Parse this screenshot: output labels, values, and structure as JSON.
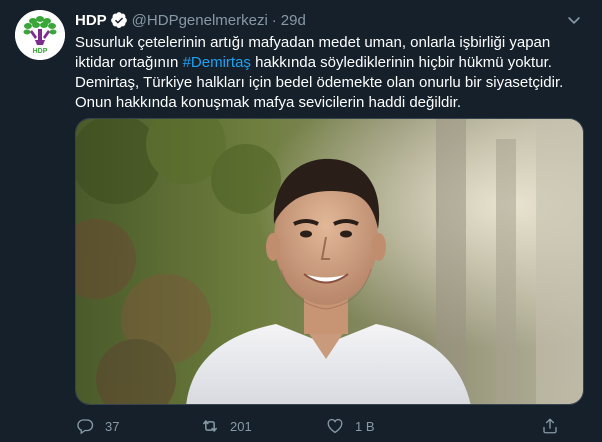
{
  "account": {
    "name": "HDP",
    "handle": "@HDPgenelmerkezi",
    "separator": "·",
    "time": "29d",
    "avatar_text": "HDP"
  },
  "tweet": {
    "line1": "Susurluk çetelerinin artığı mafyadan medet uman, onlarla işbirliği yapan",
    "line2_before": "iktidar ortağının ",
    "hashtag": "#Demirtaş",
    "line2_after": " hakkında söylediklerinin hiçbir hükmü yoktur.",
    "line3": "Demirtaş, Türkiye halkları için bedel ödemekte olan onurlu bir siyasetçidir.",
    "line4": "Onun hakkında konuşmak mafya sevicilerin haddi değildir."
  },
  "actions": {
    "reply_count": "37",
    "retweet_count": "201",
    "like_count": "1 B"
  },
  "icons": {
    "verified": "verified-badge-icon",
    "caret": "chevron-down-icon",
    "reply": "reply-icon",
    "retweet": "retweet-icon",
    "like": "heart-icon",
    "share": "share-icon"
  },
  "colors": {
    "background": "#15202b",
    "text": "#ffffff",
    "muted": "#8899a6",
    "accent": "#1da1f2",
    "logo_green": "#3aa63a",
    "logo_purple": "#7b2d8e"
  }
}
